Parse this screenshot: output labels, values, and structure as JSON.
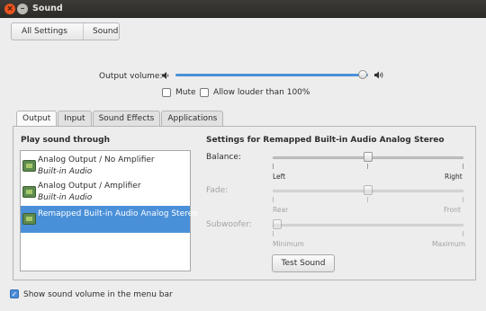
{
  "window": {
    "title": "Sound"
  },
  "nav": {
    "all_settings": "All Settings",
    "sound": "Sound"
  },
  "volume": {
    "label": "Output volume:",
    "level": 0.97,
    "mute_label": "Mute",
    "mute_checked": false,
    "louder_label": "Allow louder than 100%",
    "louder_checked": false
  },
  "tabs": [
    {
      "label": "Output",
      "active": true
    },
    {
      "label": "Input",
      "active": false
    },
    {
      "label": "Sound Effects",
      "active": false
    },
    {
      "label": "Applications",
      "active": false
    }
  ],
  "output": {
    "play_heading": "Play sound through",
    "devices": [
      {
        "name": "Analog Output / No Amplifier",
        "sub": "Built-in Audio",
        "selected": false
      },
      {
        "name": "Analog Output / Amplifier",
        "sub": "Built-in Audio",
        "selected": false
      },
      {
        "name": "Remapped Built-in Audio Analog Stereo",
        "sub": "",
        "selected": true
      }
    ],
    "settings_heading": "Settings for Remapped Built-in Audio Analog Stereo",
    "balance": {
      "label": "Balance:",
      "left": "Left",
      "right": "Right",
      "value": 0.5
    },
    "fade": {
      "label": "Fade:",
      "left": "Rear",
      "right": "Front",
      "value": 0.5
    },
    "subwoofer": {
      "label": "Subwoofer:",
      "left": "Minimum",
      "right": "Maximum",
      "value": 0.0
    },
    "test_sound": "Test Sound"
  },
  "footer": {
    "show_volume_label": "Show sound volume in the menu bar",
    "checked": true
  },
  "colors": {
    "accent": "#4a90d9",
    "titlebar": "#3c3b37",
    "close": "#e9541f"
  },
  "icons": {
    "close": "close-icon",
    "minimize": "minimize-icon",
    "speaker_low": "speaker-low-icon",
    "speaker_high": "speaker-high-icon",
    "device": "sound-card-icon"
  }
}
